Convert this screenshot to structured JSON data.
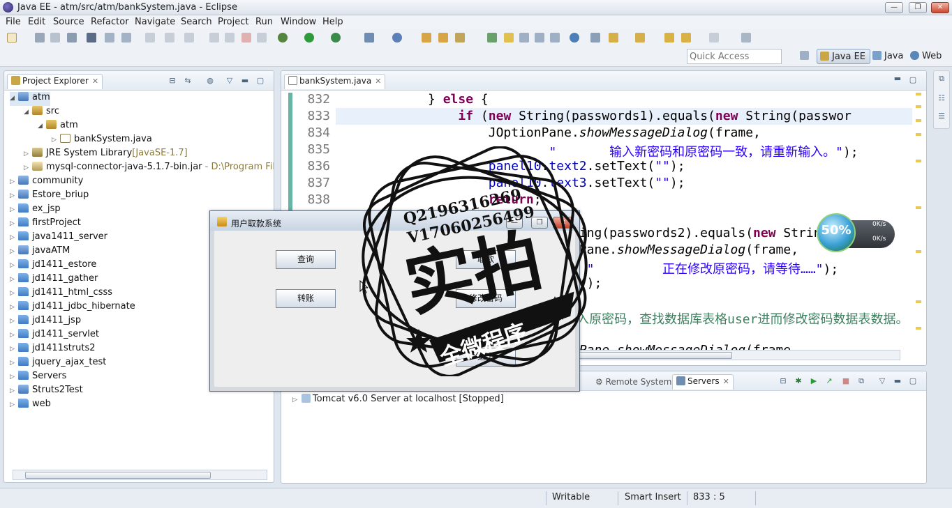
{
  "window": {
    "title": "Java EE - atm/src/atm/bankSystem.java - Eclipse",
    "minimize": "—",
    "maximize": "❐",
    "close": "✕"
  },
  "menu": [
    "File",
    "Edit",
    "Source",
    "Refactor",
    "Navigate",
    "Search",
    "Project",
    "Run",
    "Window",
    "Help"
  ],
  "toolbar": {
    "quick_access_placeholder": "Quick Access",
    "perspectives": [
      "Java EE",
      "Java",
      "Web"
    ]
  },
  "project_explorer": {
    "tab_label": "Project Explorer",
    "tree": [
      {
        "label": "atm",
        "extra": "",
        "icon": "project-icon",
        "expanded": true
      },
      {
        "label": "src",
        "extra": "",
        "icon": "package-folder-icon",
        "expanded": true
      },
      {
        "label": "atm",
        "extra": "",
        "icon": "package-icon",
        "expanded": true
      },
      {
        "label": "bankSystem.java",
        "extra": "",
        "icon": "java-file-icon",
        "expanded": false
      },
      {
        "label": "JRE System Library",
        "extra": "[JavaSE-1.7]",
        "icon": "library-icon",
        "expanded": false
      },
      {
        "label": "mysql-connector-java-5.1.7-bin.jar",
        "extra": " - D:\\Program Files\\",
        "icon": "jar-icon",
        "expanded": false
      },
      {
        "label": "community",
        "extra": "",
        "icon": "project-icon",
        "expanded": false
      },
      {
        "label": "Estore_briup",
        "extra": "",
        "icon": "project-icon",
        "expanded": false
      },
      {
        "label": "ex_jsp",
        "extra": "",
        "icon": "folder-icon",
        "expanded": false
      },
      {
        "label": "firstProject",
        "extra": "",
        "icon": "folder-icon",
        "expanded": false
      },
      {
        "label": "java1411_server",
        "extra": "",
        "icon": "folder-icon",
        "expanded": false
      },
      {
        "label": "javaATM",
        "extra": "",
        "icon": "project-icon",
        "expanded": false
      },
      {
        "label": "jd1411_estore",
        "extra": "",
        "icon": "folder-icon",
        "expanded": false
      },
      {
        "label": "jd1411_gather",
        "extra": "",
        "icon": "folder-icon",
        "expanded": false
      },
      {
        "label": "jd1411_html_csss",
        "extra": "",
        "icon": "folder-icon",
        "expanded": false
      },
      {
        "label": "jd1411_jdbc_hibernate",
        "extra": "",
        "icon": "folder-icon",
        "expanded": false
      },
      {
        "label": "jd1411_jsp",
        "extra": "",
        "icon": "folder-icon",
        "expanded": false
      },
      {
        "label": "jd1411_servlet",
        "extra": "",
        "icon": "folder-icon",
        "expanded": false
      },
      {
        "label": "jd1411struts2",
        "extra": "",
        "icon": "folder-icon",
        "expanded": false
      },
      {
        "label": "jquery_ajax_test",
        "extra": "",
        "icon": "folder-icon",
        "expanded": false
      },
      {
        "label": "Servers",
        "extra": "",
        "icon": "folder-icon",
        "expanded": false
      },
      {
        "label": "Struts2Test",
        "extra": "",
        "icon": "project-icon",
        "expanded": false
      },
      {
        "label": "web",
        "extra": "",
        "icon": "folder-icon",
        "expanded": false
      }
    ]
  },
  "editor": {
    "tab_label": "bankSystem.java",
    "lines": [
      {
        "no": "832",
        "html": "            } <span class=\"kw\">else</span> {"
      },
      {
        "no": "833",
        "html": "                <span class=\"kw\">if</span> (<span class=\"kw\">new</span> String(passwords1).equals(<span class=\"kw\">new</span> String(passwor"
      },
      {
        "no": "834",
        "html": "                    JOptionPane.<span class=\"it\">showMessageDialog</span>(frame,"
      },
      {
        "no": "835",
        "html": "                            <span class=\"str\">\"       输入新密码和原密码一致，请重新输入。\"</span>);"
      },
      {
        "no": "836",
        "html": "                    <span class=\"fld\">panel10</span>.<span class=\"fld\">text2</span>.setText(<span class=\"str\">\"\"</span>);"
      },
      {
        "no": "837",
        "html": "                    <span class=\"fld\">panel10</span>.<span class=\"fld\">text3</span>.setText(<span class=\"str\">\"\"</span>);"
      },
      {
        "no": "838",
        "html": "                    <span class=\"kw\">return</span>;"
      },
      {
        "no": "",
        "html": ""
      },
      {
        "no": "",
        "html": "                              tring(passwords2).equals(<span class=\"kw\">new</span> String(pas"
      },
      {
        "no": "",
        "html": "                              onPane.<span class=\"it\">showMessageDialog</span>(frame,"
      },
      {
        "no": "",
        "html": "                                 <span class=\"str\">\"         正在修改原密码，请等待……\"</span>);"
      },
      {
        "no": "",
        "html": "                              eM();"
      },
      {
        "no": "",
        "html": ""
      },
      {
        "no": "",
        "html": "                              <span class=\"cmt\">输入原密码，查找数据库表格user进而修改密码数据表数据。</span>"
      },
      {
        "no": "",
        "html": ""
      },
      {
        "no": "",
        "html": "                              <span class=\"it\">onPane.showMessageDialog</span>(frame,"
      }
    ]
  },
  "servers_panel": {
    "other_tab": "Remote Systems",
    "active_tab": "Servers",
    "server_row": "Tomcat v6.0 Server at localhost  [Stopped]"
  },
  "dialog": {
    "title": "用户取款系统",
    "buttons": {
      "query": "查询",
      "withdraw": "取款",
      "transfer": "转账",
      "change_password": "修改密码",
      "exit": "退出"
    }
  },
  "net_widget": {
    "percent": "50%",
    "upload": "0K/s",
    "download": "0K/s"
  },
  "status_bar": {
    "writable": "Writable",
    "insert_mode": "Smart Insert",
    "position": "833 : 5"
  },
  "watermark": {
    "line1": "Q2196316269",
    "line2": "V17060256499",
    "big": "实拍",
    "ribbon": "全微程序"
  }
}
